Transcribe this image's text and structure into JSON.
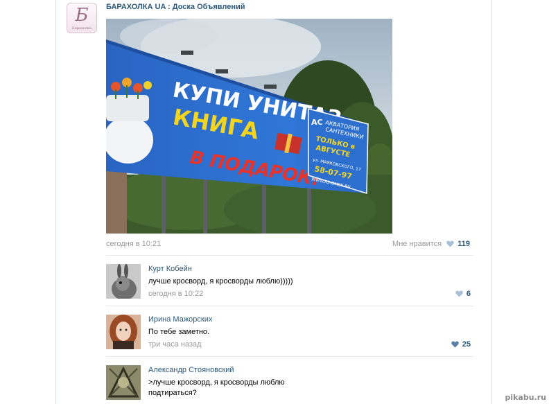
{
  "post": {
    "group_name": "БАРАХОЛКА UA : Доска Объявлений",
    "group_logo_letter": "Б",
    "group_logo_caption": "Барахолка",
    "date": "сегодня в 10:21",
    "like_label": "Мне нравится",
    "like_count": "119",
    "image": {
      "headline_1": "КУПИ УНИТАЗ -",
      "headline_2": "КНИГА",
      "headline_3": "В ПОДАРОК!",
      "side_1": "АКВАТОРИЯ",
      "side_2": "САНТЕХНИКИ",
      "side_3": "ТОЛЬКО в",
      "side_4": "АВГУСТЕ",
      "side_5": "ул. МАЯКОВСКОГО, 17",
      "side_6": "58-07-97",
      "side_7": "WWW.AS-OMSK.RU",
      "side_logo": "AC"
    }
  },
  "comments": [
    {
      "author": "Курт Кобейн",
      "text": "лучше кросворд, я кросворды люблю)))))",
      "date": "сегодня в 10:22",
      "likes": "6"
    },
    {
      "author": "Ирина Мажорских",
      "text": "По тебе заметно.",
      "date": "три часа назад",
      "likes": "25"
    },
    {
      "author": "Александр Стояновский",
      "text": ">лучше кросворд, я кросворды люблю",
      "text_2": "подтираться?"
    }
  ],
  "watermark": "pikabu.ru",
  "colors": {
    "link": "#2b587a",
    "muted": "#999999",
    "heart_active": "#5b7fa6",
    "heart_muted": "#a9bfd6"
  }
}
